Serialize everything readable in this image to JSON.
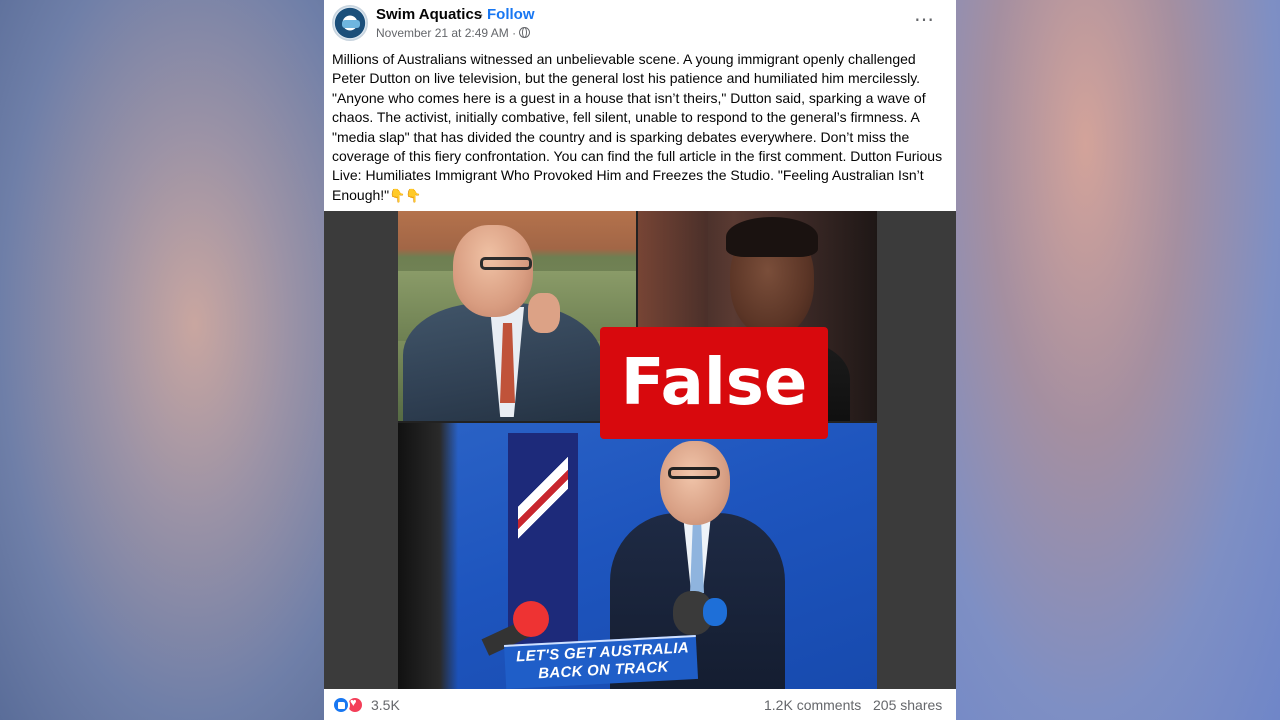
{
  "post": {
    "page_name": "Swim Aquatics",
    "separator": "·",
    "follow_label": "Follow",
    "timestamp": "November 21 at 2:49 AM ·",
    "caption": "Millions of Australians witnessed an unbelievable scene. A young immigrant openly challenged Peter Dutton on live television, but the general lost his patience and humiliated him mercilessly. \"Anyone who comes here is a guest in a house that isn’t theirs,\" Dutton said, sparking a wave of chaos. The activist, initially combative, fell silent, unable to respond to the general’s firmness. A \"media slap\" that has divided the country and is sparking debates everywhere. Don’t miss the coverage of this fiery confrontation. You can find the full article in the first comment. Dutton Furious Live: Humiliates Immigrant Who Provoked Him and Freezes the Studio. \"Feeling Australian Isn’t Enough!\"",
    "caption_emoji": "👇👇",
    "more_icon": "⋯"
  },
  "media": {
    "sign_text": "LET'S GET AUSTRALIA BACK ON TRACK",
    "rating_label": "False"
  },
  "footer": {
    "reaction_count": "3.5K",
    "comments": "1.2K comments",
    "shares": "205 shares"
  },
  "icons": {
    "avatar": "swim-aquatics-logo",
    "privacy": "globe-icon",
    "more": "more-options-icon",
    "reactions": [
      "like-icon",
      "love-icon"
    ],
    "pointing": "pointing-down-emoji"
  },
  "colors": {
    "accent": "#1877f2",
    "rating_badge": "#d8090d",
    "text_secondary": "#65676b"
  }
}
